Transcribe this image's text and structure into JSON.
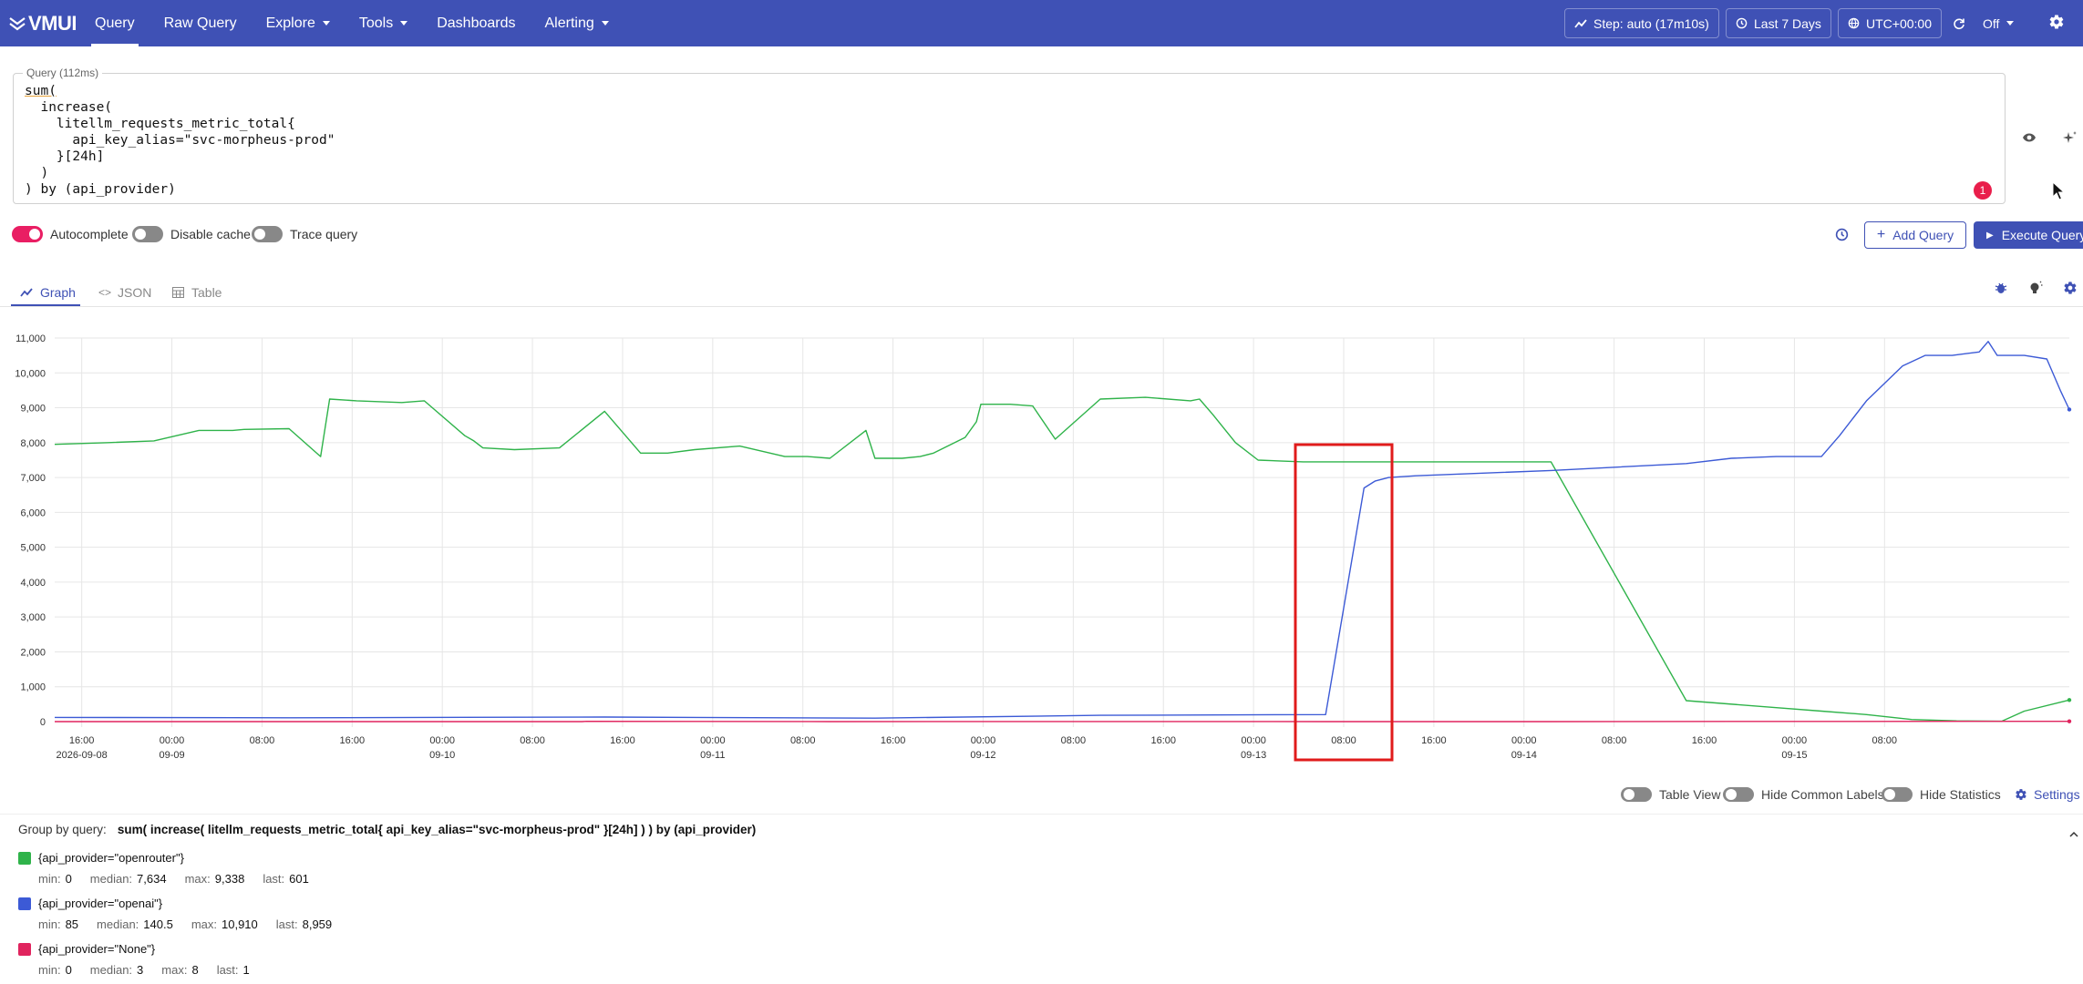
{
  "header": {
    "logo": "VMUI",
    "nav": [
      {
        "label": "Query"
      },
      {
        "label": "Raw Query"
      },
      {
        "label": "Explore"
      },
      {
        "label": "Tools"
      },
      {
        "label": "Dashboards"
      },
      {
        "label": "Alerting"
      }
    ],
    "step": "Step: auto (17m10s)",
    "range": "Last 7 Days",
    "timezone": "UTC+00:00",
    "refresh": "Off"
  },
  "query": {
    "legend": "Query (112ms)",
    "lines": [
      "sum(",
      "  increase(",
      "    litellm_requests_metric_total{",
      "      api_key_alias=\"svc-morpheus-prod\"",
      "    }[24h]",
      "  )",
      ") by (api_provider)"
    ],
    "error_count": "1"
  },
  "options": {
    "autocomplete": "Autocomplete",
    "disable_cache": "Disable cache",
    "trace_query": "Trace query",
    "add_query": "Add Query",
    "execute_query": "Execute Query"
  },
  "tabs": [
    {
      "label": "Graph"
    },
    {
      "label": "JSON"
    },
    {
      "label": "Table"
    }
  ],
  "chart_data": {
    "type": "line",
    "yticks": [
      "0",
      "1,000",
      "2,000",
      "3,000",
      "4,000",
      "5,000",
      "6,000",
      "7,000",
      "8,000",
      "9,000",
      "10,000",
      "11,000"
    ],
    "ylim": [
      0,
      11000
    ],
    "xticks": [
      {
        "t": "16:00",
        "d": "2026-09-08"
      },
      {
        "t": "00:00",
        "d": "09-09"
      },
      {
        "t": "08:00",
        "d": ""
      },
      {
        "t": "16:00",
        "d": ""
      },
      {
        "t": "00:00",
        "d": "09-10"
      },
      {
        "t": "08:00",
        "d": ""
      },
      {
        "t": "16:00",
        "d": ""
      },
      {
        "t": "00:00",
        "d": "09-11"
      },
      {
        "t": "08:00",
        "d": ""
      },
      {
        "t": "16:00",
        "d": ""
      },
      {
        "t": "00:00",
        "d": "09-12"
      },
      {
        "t": "08:00",
        "d": ""
      },
      {
        "t": "16:00",
        "d": ""
      },
      {
        "t": "00:00",
        "d": "09-13"
      },
      {
        "t": "08:00",
        "d": ""
      },
      {
        "t": "16:00",
        "d": ""
      },
      {
        "t": "00:00",
        "d": "09-14"
      },
      {
        "t": "08:00",
        "d": ""
      },
      {
        "t": "16:00",
        "d": ""
      },
      {
        "t": "00:00",
        "d": "09-15"
      },
      {
        "t": "08:00",
        "d": ""
      }
    ],
    "xlim": [
      -3.2,
      18.3
    ],
    "grid": true,
    "series": [
      {
        "name": "{api_provider=\"openrouter\"}",
        "color": "#2fb34a",
        "x": [
          -3.2,
          -2.0,
          -1.0,
          0.0,
          0.6,
          0.75,
          1.0,
          2.0,
          2.7,
          2.9,
          3.5,
          4.5,
          5.0,
          5.9,
          6.1,
          6.3,
          7.0,
          8.0,
          9.0,
          9.8,
          10.0,
          10.3,
          10.4,
          11.0,
          12.0,
          13.0,
          13.5,
          14.0,
          14.8,
          15.0,
          15.1,
          15.3,
          15.6,
          16.0,
          16.3,
          17.0,
          17.25,
          17.35,
          17.6,
          18.0,
          18.5,
          19.0,
          20.0,
          21.0,
          22.0,
          22.2,
          22.5,
          23.0,
          23.5,
          24.5,
          27.0,
          30.0,
          33.0,
          35.0,
          36.0,
          37.0,
          38.0,
          39.0,
          40.0,
          40.5,
          41.5
        ],
        "values": [
          7950,
          8000,
          8050,
          8350,
          8350,
          8350,
          8380,
          8400,
          7600,
          9250,
          9200,
          9150,
          9200,
          8200,
          8050,
          7850,
          7800,
          7850,
          8900,
          7700,
          7700,
          7700,
          7700,
          7800,
          7900,
          7600,
          7600,
          7550,
          8350,
          7550,
          7550,
          7550,
          7550,
          7600,
          7700,
          8150,
          8600,
          9100,
          9100,
          9100,
          9050,
          8100,
          9250,
          9300,
          9200,
          9250,
          8800,
          8000,
          7500,
          7450,
          7450,
          7450,
          600,
          400,
          300,
          200,
          60,
          20,
          10,
          300,
          620
        ]
      },
      {
        "name": "{api_provider=\"openai\"}",
        "color": "#3c5ad6",
        "x": [
          -3.2,
          2.0,
          9.0,
          15.0,
          20.0,
          25.0,
          25.85,
          26.1,
          26.4,
          27.0,
          30.0,
          33.0,
          34.0,
          35.0,
          36.0,
          36.4,
          37.0,
          37.8,
          38.3,
          38.9,
          39.5,
          39.7,
          39.9,
          40.5,
          41.0,
          41.3,
          41.5
        ],
        "values": [
          120,
          110,
          130,
          100,
          180,
          200,
          6700,
          6900,
          7000,
          7050,
          7200,
          7400,
          7550,
          7600,
          7600,
          8200,
          9200,
          10200,
          10500,
          10500,
          10600,
          10900,
          10500,
          10500,
          10400,
          9500,
          8950
        ]
      },
      {
        "name": "{api_provider=\"None\"}",
        "color": "#e0245e",
        "x": [
          -3.2,
          8.5,
          8.6,
          14.0,
          20.0,
          25.0,
          30.0,
          35.0,
          41.5
        ],
        "values": [
          0,
          0,
          8,
          0,
          3,
          1,
          0,
          4,
          8
        ]
      }
    ]
  },
  "bottom": {
    "table_view": "Table View",
    "hide_common_labels": "Hide Common Labels",
    "hide_statistics": "Hide Statistics",
    "settings": "Settings",
    "group_by_label": "Group by query:",
    "group_by_query": "sum( increase( litellm_requests_metric_total{ api_key_alias=\"svc-morpheus-prod\" }[24h] ) ) by (api_provider)"
  },
  "legend": [
    {
      "name": "{api_provider=\"openrouter\"}",
      "color": "#2fb34a",
      "min": "0",
      "median": "7,634",
      "max": "9,338",
      "last": "601"
    },
    {
      "name": "{api_provider=\"openai\"}",
      "color": "#3c5ad6",
      "min": "85",
      "median": "140.5",
      "max": "10,910",
      "last": "8,959"
    },
    {
      "name": "{api_provider=\"None\"}",
      "color": "#e0245e",
      "min": "0",
      "median": "3",
      "max": "8",
      "last": "1"
    }
  ],
  "stat_labels": {
    "min": "min:",
    "median": "median:",
    "max": "max:",
    "last": "last:"
  }
}
